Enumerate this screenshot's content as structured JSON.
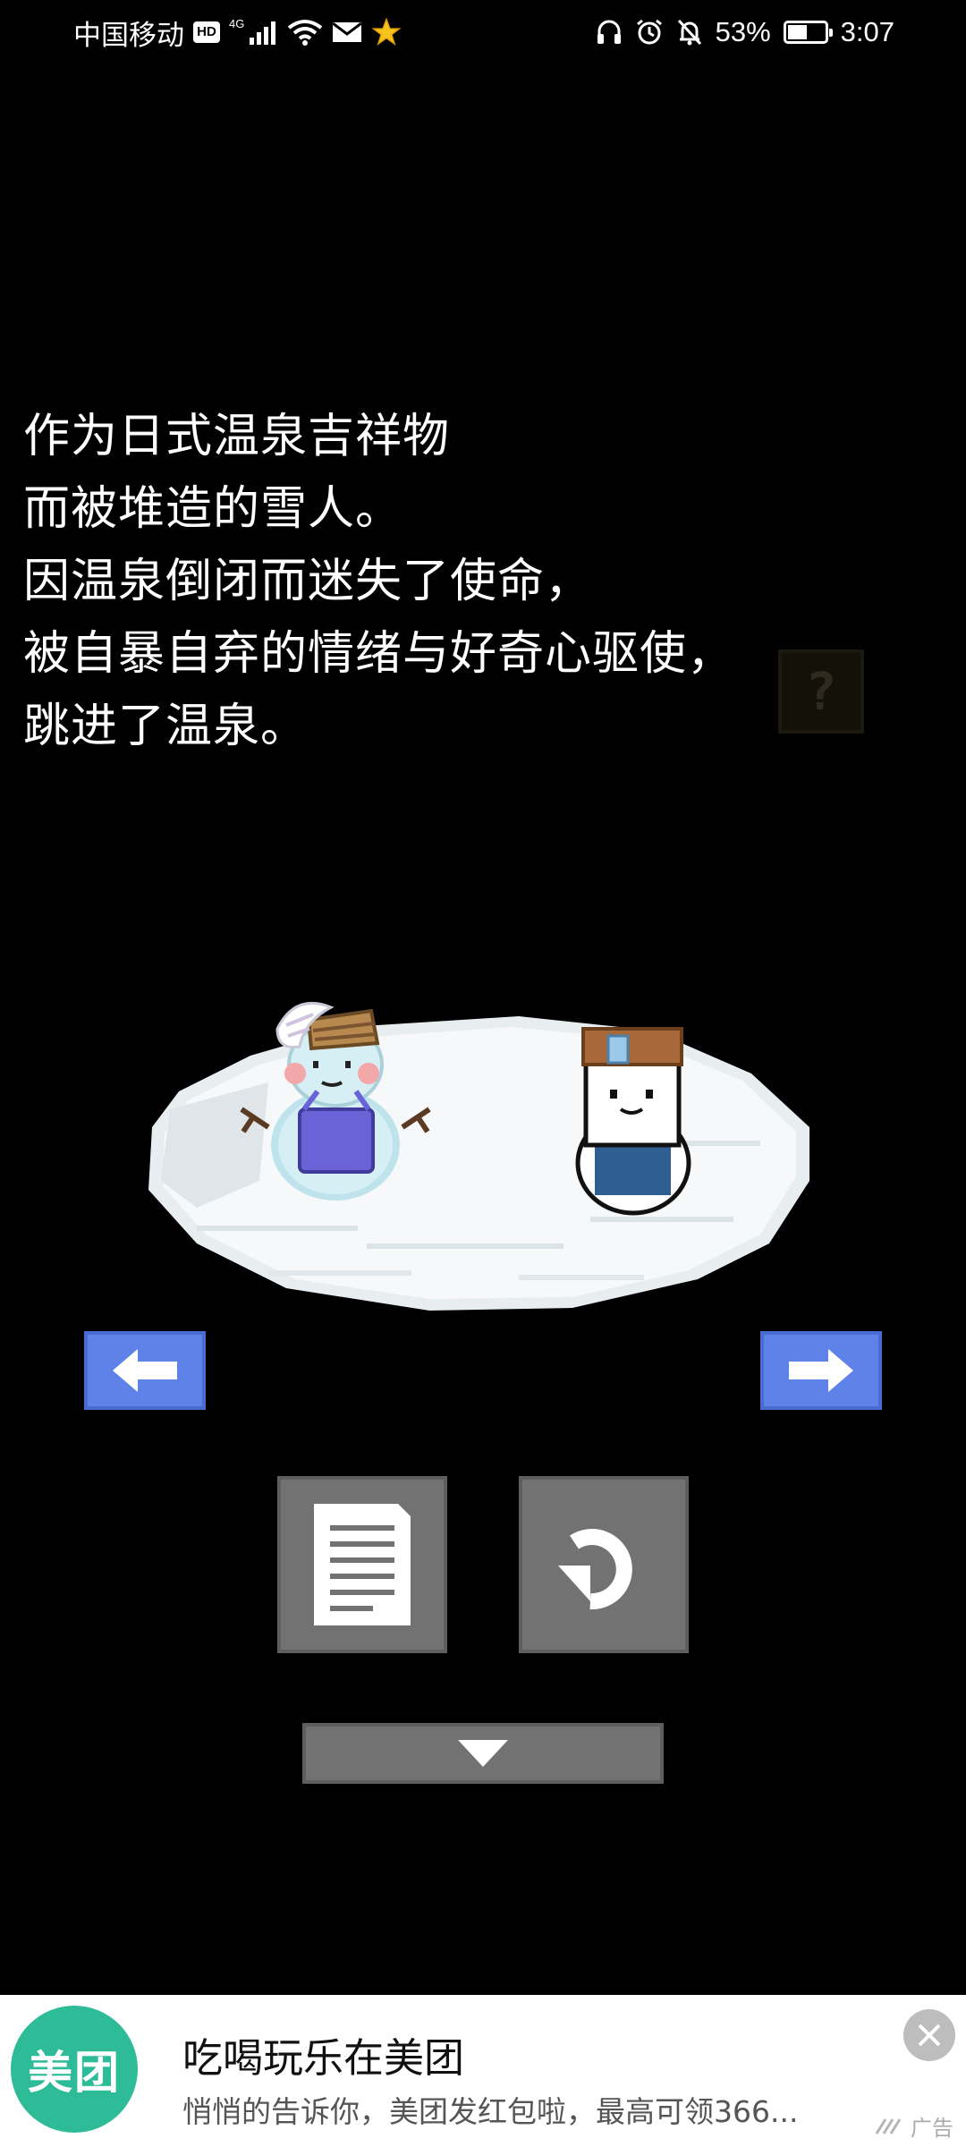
{
  "status_bar": {
    "carrier": "中国移动",
    "hd_badge": "HD",
    "network": "4G",
    "battery_percent": "53%",
    "battery_level": 0.53,
    "time": "3:07",
    "left_icons": [
      "hd-icon",
      "signal-icon",
      "wifi-icon",
      "mail-icon",
      "star-icon"
    ],
    "right_icons": [
      "headphones-icon",
      "alarm-icon",
      "mute-bell-icon",
      "battery-icon"
    ]
  },
  "story": {
    "lines": [
      "作为日式温泉吉祥物",
      "而被堆造的雪人。",
      "因温泉倒闭而迷失了使命，",
      "被自暴自弃的情绪与好奇心驱使，",
      "跳进了温泉。"
    ]
  },
  "hint": {
    "label": "?"
  },
  "scene": {
    "characters": [
      "snowman-with-basket-hat",
      "boy-with-bucket-hat"
    ]
  },
  "controls": {
    "left_arrow_icon": "arrow-left-icon",
    "right_arrow_icon": "arrow-right-icon",
    "document_icon": "document-icon",
    "undo_icon": "undo-icon",
    "down_icon": "chevron-down-icon"
  },
  "colors": {
    "arrow_button": "#5f82e8",
    "tool_button": "#727272",
    "ad_brand": "#2dbb98"
  },
  "ad": {
    "logo_text": "美团",
    "title": "吃喝玩乐在美团",
    "subtitle": "悄悄的告诉你，美团发红包啦，最高可领366...",
    "tag": "广告"
  }
}
